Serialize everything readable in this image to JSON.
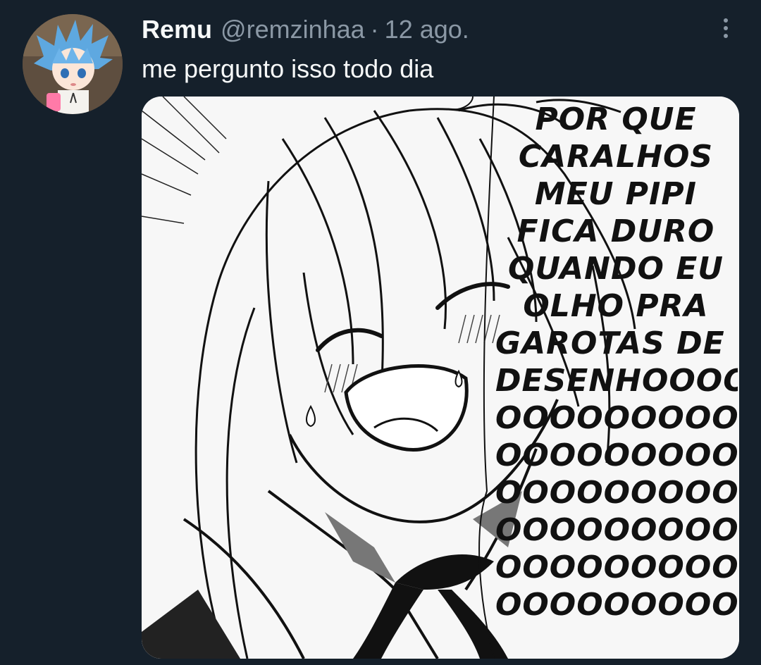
{
  "tweet": {
    "author_name": "Remu",
    "handle": "@remzinhaa",
    "separator": "·",
    "date": "12 ago.",
    "text": "me pergunto isso todo dia",
    "more_icon": "more-vertical-icon"
  },
  "media": {
    "caption_lines": [
      "POR QUE",
      "CARALHOS",
      "MEU PIPI",
      "FICA DURO",
      "QUANDO EU",
      "OLHO PRA",
      "GAROTAS DE",
      "DESENHOOOO",
      "OOOOOOOOOOO",
      "OOOOOOOOOOO",
      "OOOOOOOOOOO",
      "OOOOOOOOOOO",
      "OOOOOOOOOOO",
      "OOOOOOOOOO"
    ]
  },
  "colors": {
    "background": "#15202b",
    "primary_text": "#f7f9f9",
    "secondary_text": "#8b98a5"
  }
}
